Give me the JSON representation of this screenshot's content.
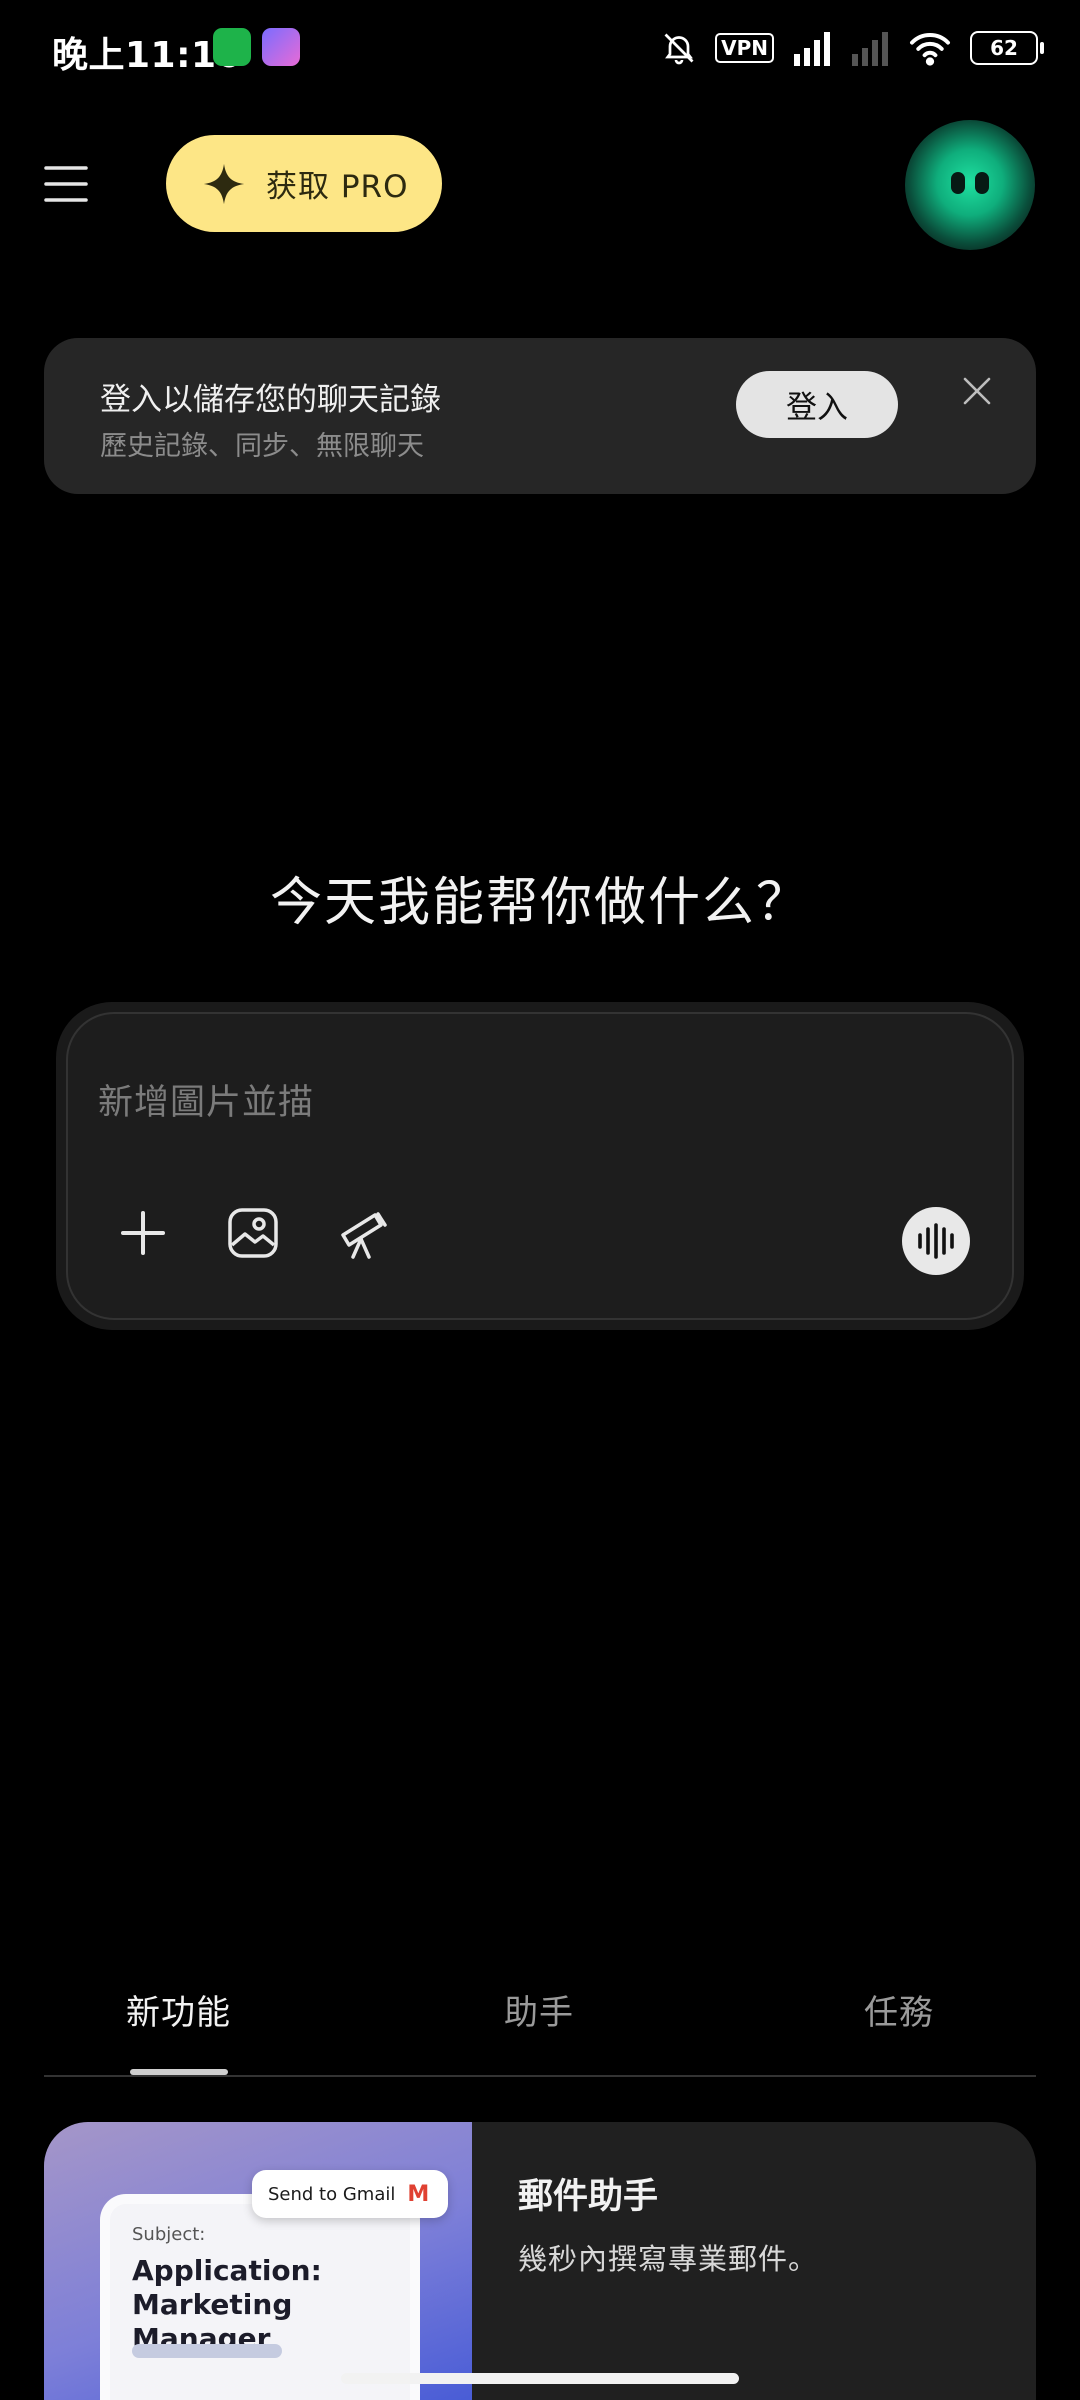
{
  "status_bar": {
    "time": "晚上11:10",
    "vpn_label": "VPN",
    "battery": "62"
  },
  "top_bar": {
    "pro_label": "获取 PRO"
  },
  "login_banner": {
    "title": "登入以儲存您的聊天記錄",
    "subtitle": "歷史記錄、同步、無限聊天",
    "login_label": "登入"
  },
  "main": {
    "greeting": "今天我能帮你做什么？",
    "input_placeholder": "新增圖片並描"
  },
  "tabs": [
    {
      "label": "新功能",
      "active": true
    },
    {
      "label": "助手",
      "active": false
    },
    {
      "label": "任務",
      "active": false
    }
  ],
  "feature_card": {
    "title": "郵件助手",
    "description": "幾秒內撰寫專業郵件。",
    "thumb_subject_label": "Subject:",
    "thumb_subject": "Application: Marketing Manager",
    "thumb_send_label": "Send to Gmail",
    "thumb_gmail_logo": "M"
  },
  "colors": {
    "background": "#000000",
    "pro_button": "#fde686",
    "card": "#262626",
    "avatar_accent": "#1fe0a0"
  }
}
